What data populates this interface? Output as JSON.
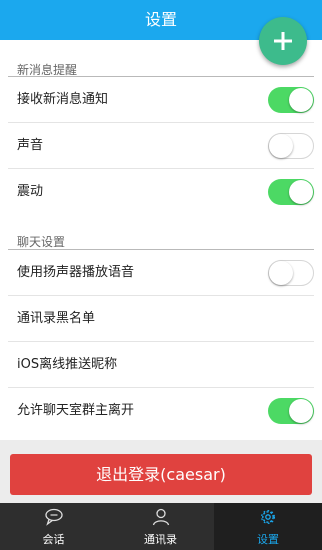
{
  "header": {
    "title": "设置"
  },
  "fab": {
    "icon": "plus-icon"
  },
  "sections": [
    {
      "title": "新消息提醒"
    },
    {
      "title": "聊天设置"
    }
  ],
  "rows": [
    {
      "label": "接收新消息通知",
      "toggle": true,
      "on": true
    },
    {
      "label": "声音",
      "toggle": true,
      "on": false
    },
    {
      "label": "震动",
      "toggle": true,
      "on": true
    },
    {
      "label": "使用扬声器播放语音",
      "toggle": true,
      "on": false
    },
    {
      "label": "通讯录黑名单"
    },
    {
      "label": "iOS离线推送昵称"
    },
    {
      "label": "允许聊天室群主离开",
      "toggle": true,
      "on": true
    }
  ],
  "logout_button": {
    "label": "退出登录(caesar)"
  },
  "tabs": [
    {
      "label": "会话",
      "icon": "chat-bubble-icon",
      "active": false
    },
    {
      "label": "通讯录",
      "icon": "person-icon",
      "active": false
    },
    {
      "label": "设置",
      "icon": "gear-icon",
      "active": true
    }
  ],
  "colors": {
    "header": "#1ba8ee",
    "fab": "#3dbb8c",
    "toggle_on": "#4cd964",
    "logout": "#e0423f",
    "tabbar": "#2e2e2e",
    "tab_active_label": "#1ba8ee"
  }
}
